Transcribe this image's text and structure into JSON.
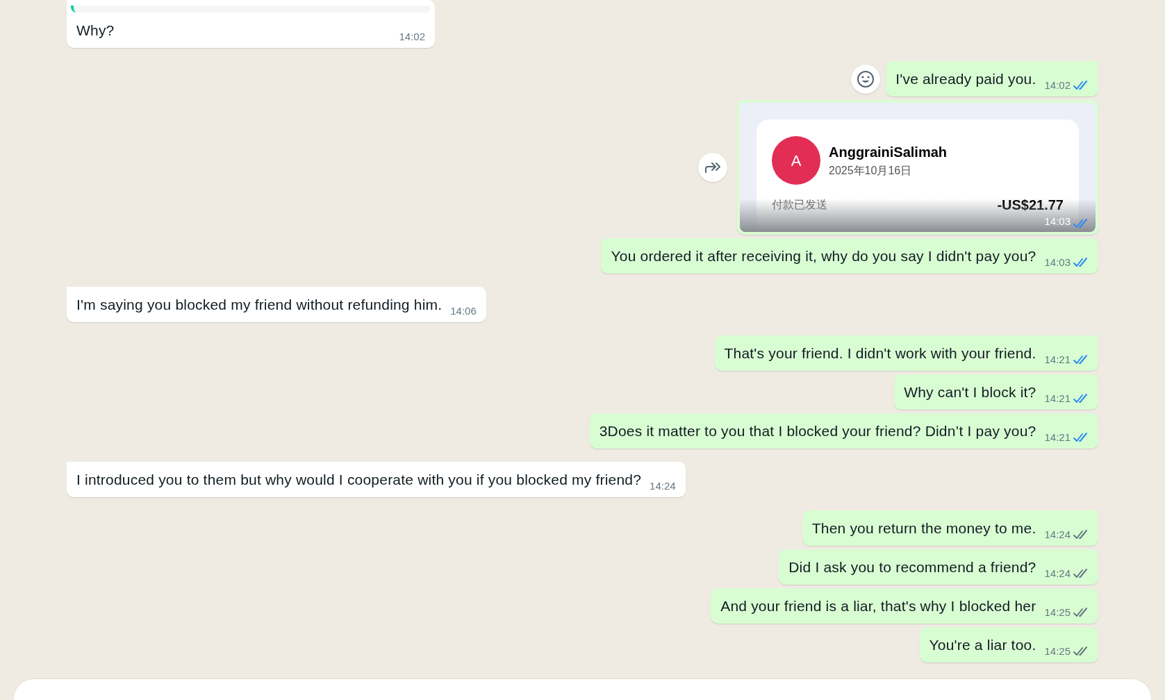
{
  "messages": [
    {
      "kind": "text",
      "outgoing": false,
      "quoted": true,
      "emoji_button": false,
      "forward_button": false,
      "read": false,
      "text": "Why?",
      "time": "14:02"
    },
    {
      "kind": "text",
      "outgoing": true,
      "quoted": false,
      "emoji_button": true,
      "forward_button": false,
      "read": true,
      "text": "I've already paid you.",
      "time": "14:02"
    },
    {
      "kind": "payment",
      "outgoing": true,
      "quoted": false,
      "emoji_button": false,
      "forward_button": true,
      "read": true,
      "avatar_letter": "A",
      "name": "AnggrainiSalimah",
      "date": "2025年10月16日",
      "label": "付款已发送",
      "amount": "-US$21.77",
      "time": "14:03"
    },
    {
      "kind": "text",
      "outgoing": true,
      "quoted": false,
      "emoji_button": false,
      "forward_button": false,
      "read": true,
      "text": "You ordered it after receiving it, why do you say I didn't pay you?",
      "time": "14:03"
    },
    {
      "kind": "text",
      "outgoing": false,
      "quoted": false,
      "emoji_button": false,
      "forward_button": false,
      "read": false,
      "text": "I'm saying you blocked my friend without refunding him.",
      "time": "14:06"
    },
    {
      "kind": "text",
      "outgoing": true,
      "quoted": false,
      "emoji_button": false,
      "forward_button": false,
      "read": true,
      "text": "That's your friend. I didn't work with your friend.",
      "time": "14:21"
    },
    {
      "kind": "text",
      "outgoing": true,
      "quoted": false,
      "emoji_button": false,
      "forward_button": false,
      "read": true,
      "text": "Why can't I block it?",
      "time": "14:21"
    },
    {
      "kind": "text",
      "outgoing": true,
      "quoted": false,
      "emoji_button": false,
      "forward_button": false,
      "read": true,
      "text": "3Does it matter to you that I blocked your friend? Didn’t I pay you?",
      "time": "14:21"
    },
    {
      "kind": "text",
      "outgoing": false,
      "quoted": false,
      "emoji_button": false,
      "forward_button": false,
      "read": false,
      "text": "I introduced you to them but why would I cooperate with you if you blocked my friend?",
      "time": "14:24"
    },
    {
      "kind": "text",
      "outgoing": true,
      "quoted": false,
      "emoji_button": false,
      "forward_button": false,
      "read": false,
      "text": "Then you return the money to me.",
      "time": "14:24"
    },
    {
      "kind": "text",
      "outgoing": true,
      "quoted": false,
      "emoji_button": false,
      "forward_button": false,
      "read": false,
      "text": "Did I ask you to recommend a friend?",
      "time": "14:24"
    },
    {
      "kind": "text",
      "outgoing": true,
      "quoted": false,
      "emoji_button": false,
      "forward_button": false,
      "read": false,
      "text": "And your friend is a liar, that's why I blocked her",
      "time": "14:25"
    },
    {
      "kind": "text",
      "outgoing": true,
      "quoted": false,
      "emoji_button": false,
      "forward_button": false,
      "read": false,
      "text": "You're a liar too.",
      "time": "14:25"
    }
  ]
}
